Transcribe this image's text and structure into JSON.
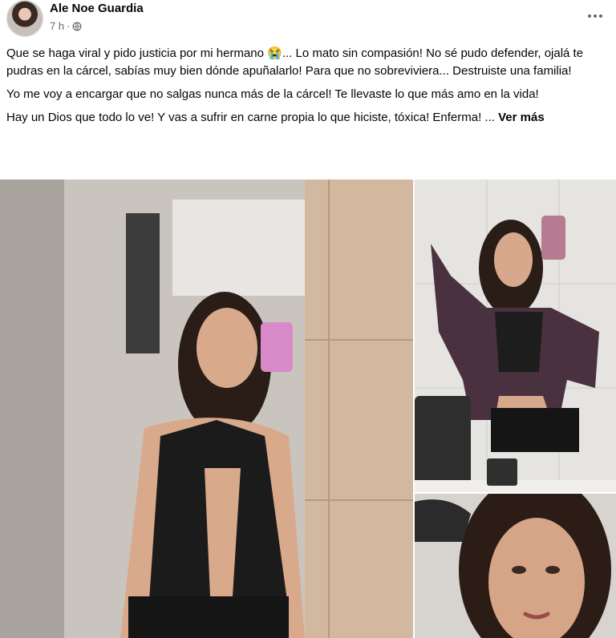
{
  "post": {
    "author": "Ale Noe Guardia",
    "time": "7 h",
    "separator": "·",
    "icons": {
      "avatar": "profile-avatar",
      "privacy": "globe-icon",
      "menu": "more-options-icon"
    },
    "paragraphs": [
      "Que se haga viral y pido justicia por mi hermano 😭... Lo mato sin compasión! No sé pudo defender, ojalá te pudras en la cárcel, sabías muy bien dónde apuñalarlo! Para que no sobreviviera... Destruiste una familia!",
      "Yo me voy a encargar que no salgas nunca más de la cárcel! Te llevaste lo que más amo en la vida!",
      "Hay un Dios que todo lo ve! Y vas a sufrir en carne propia lo que hiciste, tóxica! Enferma! ..."
    ],
    "see_more": "Ver más"
  },
  "photos": [
    {
      "name": "mirror-selfie-bathroom"
    },
    {
      "name": "mirror-selfie-jacket"
    },
    {
      "name": "portrait-closeup"
    }
  ]
}
